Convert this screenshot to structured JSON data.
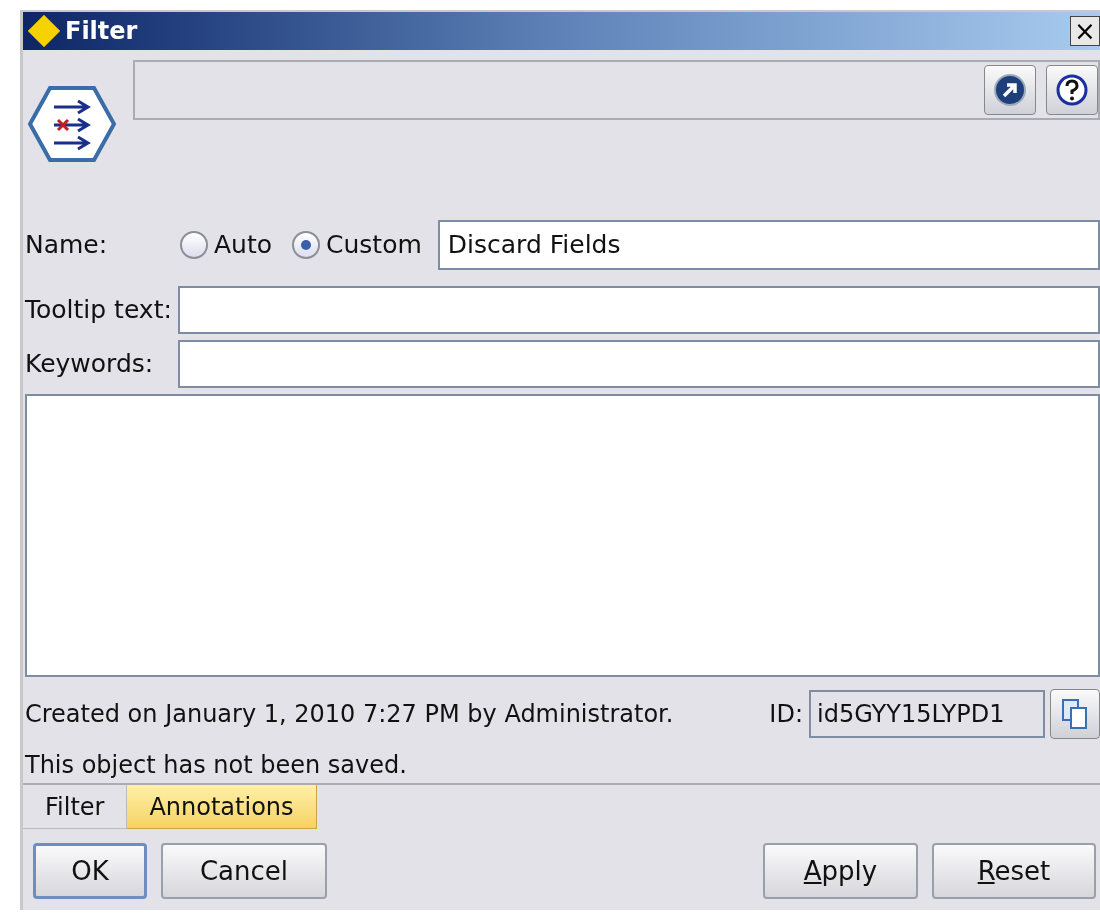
{
  "window": {
    "title": "Filter",
    "close": "×"
  },
  "name": {
    "label": "Name:",
    "options": [
      {
        "label": "Auto",
        "selected": false
      },
      {
        "label": "Custom",
        "selected": true
      }
    ],
    "value": "Discard Fields"
  },
  "tooltip": {
    "label": "Tooltip text:"
  },
  "keywords": {
    "label": "Keywords:"
  },
  "created": "Created on January 1, 2010 7:27 PM by Administrator.",
  "id": {
    "label": "ID:",
    "value": "id5GYY15LYPD1"
  },
  "saved_note": "This object has not been saved.",
  "tabs": [
    {
      "label": "Filter",
      "selected": false
    },
    {
      "label": "Annotations",
      "selected": true
    }
  ],
  "buttons_left": [
    {
      "label": "OK",
      "default": true
    },
    {
      "label": "Cancel",
      "default": false
    }
  ],
  "buttons_right": [
    {
      "mnemonic": "A",
      "rest": "pply"
    },
    {
      "mnemonic": "R",
      "rest": "eset"
    }
  ]
}
